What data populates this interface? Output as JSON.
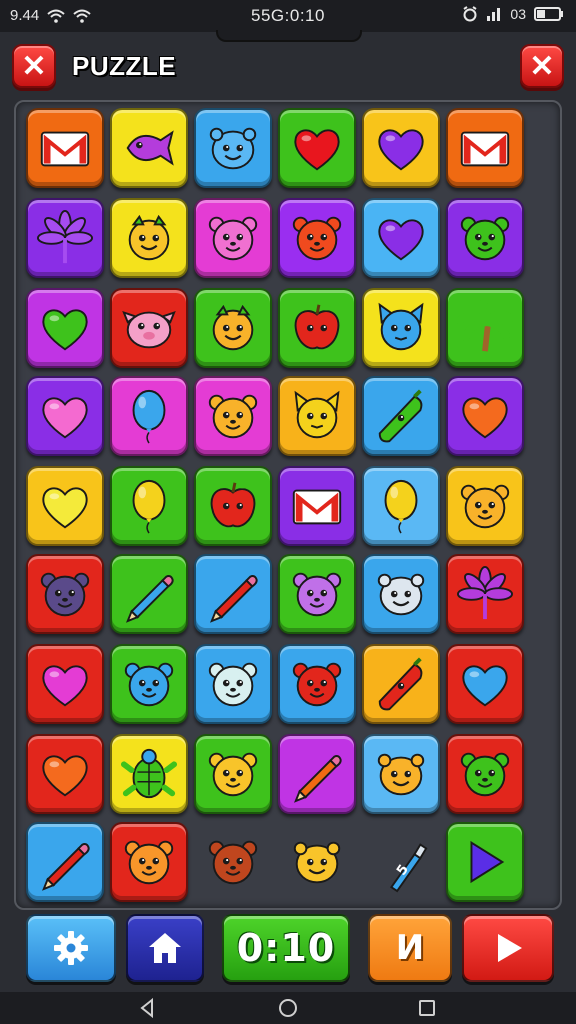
{
  "status_bar": {
    "time_left": "9.44",
    "clock": "55G:0:10",
    "right_text": "03"
  },
  "header": {
    "title": "PUZZLE",
    "close_left_icon": "close-icon",
    "close_right_icon": "close-icon"
  },
  "board": {
    "rows": [
      [
        {
          "bg": "#f06a12",
          "icon": "gmail",
          "c": "#e2261c"
        },
        {
          "bg": "#f4e21c",
          "icon": "fish",
          "c": "#b43cdc"
        },
        {
          "bg": "#3aa6ec",
          "icon": "creature",
          "c": "#5ab8f4"
        },
        {
          "bg": "#3ec21c",
          "icon": "heart",
          "c": "#e8161e"
        },
        {
          "bg": "#f8c41a",
          "icon": "heart",
          "c": "#8a2ee6"
        },
        {
          "bg": "#f06a12",
          "icon": "gmail",
          "c": "#e2261c"
        }
      ],
      [
        {
          "bg": "#8a2ee6",
          "icon": "flower",
          "c": "#a64cf0"
        },
        {
          "bg": "#f4e21c",
          "icon": "face",
          "c": "#f8c42a"
        },
        {
          "bg": "#e43cd4",
          "icon": "bear",
          "c": "#f070d0"
        },
        {
          "bg": "#9a2ef0",
          "icon": "bear",
          "c": "#f04a1e"
        },
        {
          "bg": "#4ab4f4",
          "icon": "heart",
          "c": "#8a2ee6"
        },
        {
          "bg": "#8a2ee6",
          "icon": "bear",
          "c": "#3ec21c"
        }
      ],
      [
        {
          "bg": "#c034e4",
          "icon": "heart",
          "c": "#3ec21c"
        },
        {
          "bg": "#e2261c",
          "icon": "pig",
          "c": "#f4a0c8"
        },
        {
          "bg": "#3ec21c",
          "icon": "face",
          "c": "#f8b22a"
        },
        {
          "bg": "#3ec21c",
          "icon": "apple",
          "c": "#e2261c"
        },
        {
          "bg": "#f4e21c",
          "icon": "cat",
          "c": "#3aa6ec"
        },
        {
          "bg": "#3ec21c",
          "icon": "palm",
          "c": "#3ec21c"
        }
      ],
      [
        {
          "bg": "#8a2ee6",
          "icon": "heart",
          "c": "#f46ad0"
        },
        {
          "bg": "#e43cd4",
          "icon": "balloon",
          "c": "#3aa6ec"
        },
        {
          "bg": "#e43cd4",
          "icon": "bear",
          "c": "#f8b22a"
        },
        {
          "bg": "#f8b21a",
          "icon": "cat",
          "c": "#f4d21c"
        },
        {
          "bg": "#3aa6ec",
          "icon": "pepper",
          "c": "#3ec21c"
        },
        {
          "bg": "#8a2ee6",
          "icon": "heart",
          "c": "#f46a1e"
        }
      ],
      [
        {
          "bg": "#f8c41a",
          "icon": "heart",
          "c": "#f4ea3a"
        },
        {
          "bg": "#3ec21c",
          "icon": "balloon",
          "c": "#f4d21c"
        },
        {
          "bg": "#3ec21c",
          "icon": "apple",
          "c": "#e2261c"
        },
        {
          "bg": "#8a2ee6",
          "icon": "gmail",
          "c": "#e2261c"
        },
        {
          "bg": "#5ab8f4",
          "icon": "balloon",
          "c": "#f4d21c"
        },
        {
          "bg": "#f8c41a",
          "icon": "bear",
          "c": "#f8b22a"
        }
      ],
      [
        {
          "bg": "#e2261c",
          "icon": "bear",
          "c": "#5a4a8a"
        },
        {
          "bg": "#3ec21c",
          "icon": "pencil",
          "c": "#3aa6ec"
        },
        {
          "bg": "#3aa6ec",
          "icon": "pencil",
          "c": "#e2261c"
        },
        {
          "bg": "#3ec21c",
          "icon": "bear",
          "c": "#c070e8"
        },
        {
          "bg": "#3aa6ec",
          "icon": "creature",
          "c": "#dde6ee"
        },
        {
          "bg": "#e2261c",
          "icon": "flower",
          "c": "#b43cdc"
        }
      ],
      [
        {
          "bg": "#e2261c",
          "icon": "heart",
          "c": "#e43cd4"
        },
        {
          "bg": "#3ec21c",
          "icon": "bear",
          "c": "#3aa6ec"
        },
        {
          "bg": "#3aa6ec",
          "icon": "bear",
          "c": "#d8f0f0"
        },
        {
          "bg": "#3aa6ec",
          "icon": "bear",
          "c": "#e2261c"
        },
        {
          "bg": "#f8b21a",
          "icon": "pepper",
          "c": "#e2261c"
        },
        {
          "bg": "#e2261c",
          "icon": "heart",
          "c": "#3aa6ec"
        }
      ],
      [
        {
          "bg": "#e2261c",
          "icon": "heart",
          "c": "#f46a1e"
        },
        {
          "bg": "#f4e21c",
          "icon": "turtle",
          "c": "#3ec21c"
        },
        {
          "bg": "#3ec21c",
          "icon": "bear",
          "c": "#f8c42a"
        },
        {
          "bg": "#c034e4",
          "icon": "pencil",
          "c": "#f06a12"
        },
        {
          "bg": "#5ab8f4",
          "icon": "creature",
          "c": "#f8b22a"
        },
        {
          "bg": "#e2261c",
          "icon": "bear",
          "c": "#3ec21c"
        }
      ],
      [
        {
          "bg": "#3aa6ec",
          "icon": "pencil",
          "c": "#e2261c"
        },
        {
          "bg": "#e2261c",
          "icon": "bear",
          "c": "#f8962a"
        },
        {
          "bg": "none",
          "icon": "bear",
          "c": "#c0461e"
        },
        {
          "bg": "none",
          "icon": "creature",
          "c": "#f8c42a"
        },
        {
          "bg": "none",
          "icon": "bottle",
          "c": "#3aa6ec"
        },
        {
          "bg": "#3ec21c",
          "icon": "play",
          "c": "#5a2ee6"
        }
      ]
    ]
  },
  "bottom_bar": {
    "settings_icon": "gear-icon",
    "home_icon": "home-icon",
    "timer": "0:10",
    "level": "И",
    "play_icon": "play-icon"
  },
  "nav_bar": {
    "back_icon": "back-icon",
    "home_icon": "home-circle-icon",
    "recent_icon": "recent-apps-icon"
  }
}
